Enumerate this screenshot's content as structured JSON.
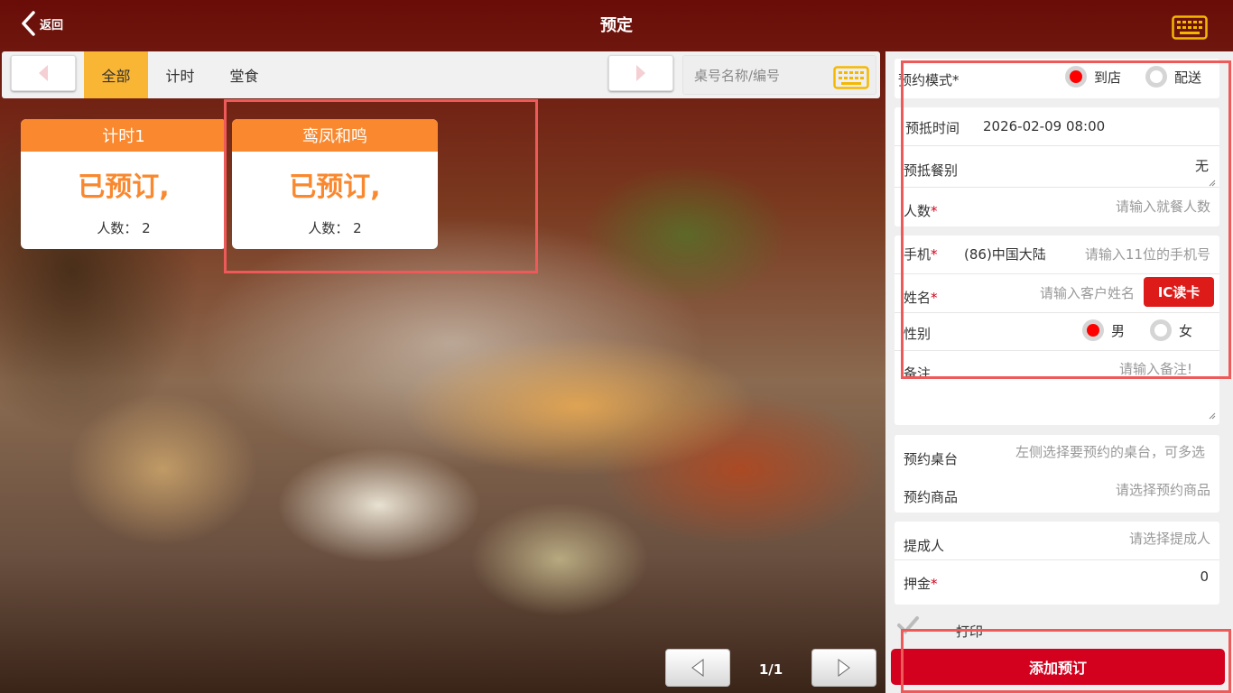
{
  "header": {
    "back_label": "返回",
    "title": "预定"
  },
  "filter": {
    "tabs": [
      "全部",
      "计时",
      "堂食"
    ],
    "active_tab": "全部",
    "search_placeholder": "桌号名称/编号"
  },
  "tables": [
    {
      "name": "计时1",
      "status": "已预订,",
      "people": "人数： 2"
    },
    {
      "name": "鸾凤和鸣",
      "status": "已预订,",
      "people": "人数： 2"
    }
  ],
  "pager": {
    "page": "1/1"
  },
  "form": {
    "mode_label": "预约模式*",
    "mode_options": [
      "到店",
      "配送"
    ],
    "mode_selected": "到店",
    "time_label": "预抵时间",
    "time_value": "2026-02-09 08:00",
    "meal_label": "预抵餐别",
    "meal_value": "无",
    "people_label": "人数",
    "people_placeholder": "请输入就餐人数",
    "phone_label": "手机",
    "phone_region": "(86)中国大陆",
    "phone_placeholder": "请输入11位的手机号",
    "name_label": "姓名",
    "name_placeholder": "请输入客户姓名",
    "ic_button": "IC读卡",
    "gender_label": "性别",
    "gender_options": [
      "男",
      "女"
    ],
    "gender_selected": "男",
    "remark_label": "备注",
    "remark_placeholder": "请输入备注!",
    "table_label": "预约桌台",
    "table_placeholder": "左侧选择要预约的桌台，可多选",
    "goods_label": "预约商品",
    "goods_placeholder": "请选择预约商品",
    "commission_label": "提成人",
    "commission_placeholder": "请选择提成人",
    "deposit_label": "押金",
    "deposit_value": "0",
    "required_mark": "*",
    "print_label": "打印",
    "submit_label": "添加预订"
  },
  "colors": {
    "accent_orange": "#f9882e",
    "tab_active": "#f9b534",
    "primary_red": "#d3001e",
    "highlight": "#ee5a5a"
  }
}
